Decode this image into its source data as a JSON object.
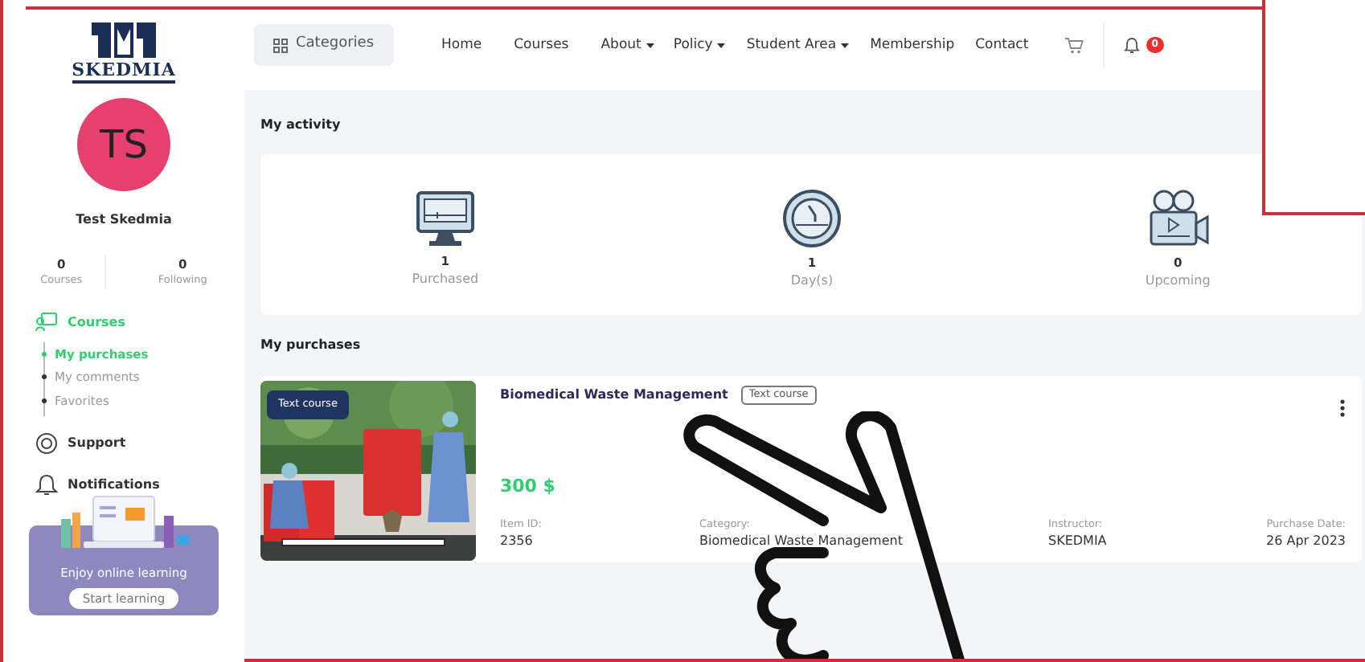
{
  "logo": {
    "text": "SKEDMIA"
  },
  "header": {
    "categories": "Categories",
    "nav": [
      {
        "label": "Home",
        "dropdown": false
      },
      {
        "label": "Courses",
        "dropdown": false
      },
      {
        "label": "About",
        "dropdown": true
      },
      {
        "label": "Policy",
        "dropdown": true
      },
      {
        "label": "Student Area",
        "dropdown": true
      },
      {
        "label": "Membership",
        "dropdown": false
      },
      {
        "label": "Contact",
        "dropdown": false
      }
    ],
    "notifications_count": "0"
  },
  "profile": {
    "initials": "TS",
    "name": "Test Skedmia",
    "stats": [
      {
        "value": "0",
        "label": "Courses"
      },
      {
        "value": "0",
        "label": "Following"
      }
    ]
  },
  "sidebar": {
    "items": [
      {
        "label": "Courses",
        "kind": "courses",
        "selected": true,
        "children": [
          {
            "label": "My purchases",
            "selected": true
          },
          {
            "label": "My comments",
            "selected": false
          },
          {
            "label": "Favorites",
            "selected": false
          }
        ]
      },
      {
        "label": "Support",
        "kind": "support",
        "selected": false
      },
      {
        "label": "Notifications",
        "kind": "bell",
        "selected": false
      }
    ],
    "promo": {
      "text": "Enjoy online learning",
      "button": "Start learning"
    }
  },
  "activity": {
    "title": "My activity",
    "stats": [
      {
        "kind": "monitor",
        "value": "1",
        "label": "Purchased"
      },
      {
        "kind": "gauge",
        "value": "1",
        "label": "Day(s)"
      },
      {
        "kind": "camera",
        "value": "0",
        "label": "Upcoming"
      }
    ]
  },
  "purchases": {
    "title": "My purchases",
    "items": [
      {
        "badge": "Text course",
        "title": "Biomedical Waste Management",
        "tag": "Text course",
        "price": "300 $",
        "level": 1,
        "meta": [
          {
            "label": "Item ID:",
            "value": "2356"
          },
          {
            "label": "Category:",
            "value": "Biomedical Waste Management"
          },
          {
            "label": "Instructor:",
            "value": "SKEDMIA"
          },
          {
            "label": "Purchase Date:",
            "value": "26 Apr 2023"
          }
        ]
      }
    ]
  }
}
